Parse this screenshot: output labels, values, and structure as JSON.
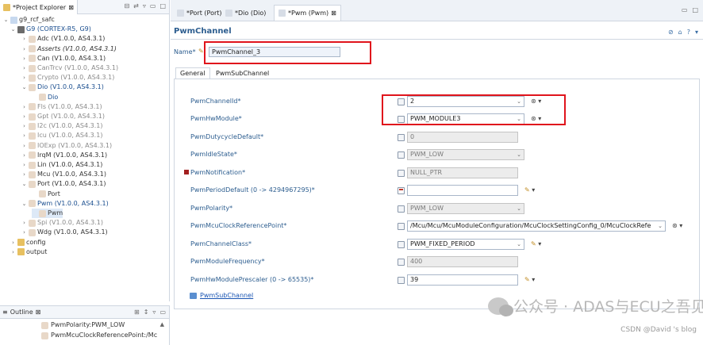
{
  "project_explorer": {
    "title": "*Project Explorer",
    "tree": [
      {
        "label": "g9_rcf_safc",
        "depth": 0,
        "twisty": "v",
        "icon": "project-icon",
        "color": "dark"
      },
      {
        "label": "G9 (CORTEX-R5, G9)",
        "depth": 1,
        "twisty": "v",
        "icon": "chip-icon",
        "color": "blue"
      },
      {
        "label": "Adc (V1.0.0, AS4.3.1)",
        "depth": 2,
        "twisty": ">",
        "icon": "module-icon",
        "color": "dark"
      },
      {
        "label": "Asserts (V1.0.0, AS4.3.1)",
        "depth": 2,
        "twisty": ">",
        "icon": "module-icon",
        "color": "dark",
        "italic": true
      },
      {
        "label": "Can (V1.0.0, AS4.3.1)",
        "depth": 2,
        "twisty": ">",
        "icon": "module-icon",
        "color": "dark"
      },
      {
        "label": "CanTrcv (V1.0.0, AS4.3.1)",
        "depth": 2,
        "twisty": ">",
        "icon": "module-icon",
        "color": "grey"
      },
      {
        "label": "Crypto (V1.0.0, AS4.3.1)",
        "depth": 2,
        "twisty": ">",
        "icon": "module-icon",
        "color": "grey"
      },
      {
        "label": "Dio (V1.0.0, AS4.3.1)",
        "depth": 2,
        "twisty": "v",
        "icon": "module-icon",
        "color": "blue"
      },
      {
        "label": "Dio",
        "depth": 3,
        "twisty": "",
        "icon": "module-icon",
        "color": "blue"
      },
      {
        "label": "Fls (V1.0.0, AS4.3.1)",
        "depth": 2,
        "twisty": ">",
        "icon": "module-icon",
        "color": "grey"
      },
      {
        "label": "Gpt (V1.0.0, AS4.3.1)",
        "depth": 2,
        "twisty": ">",
        "icon": "module-icon",
        "color": "grey"
      },
      {
        "label": "I2c (V1.0.0, AS4.3.1)",
        "depth": 2,
        "twisty": ">",
        "icon": "module-icon",
        "color": "grey"
      },
      {
        "label": "Icu (V1.0.0, AS4.3.1)",
        "depth": 2,
        "twisty": ">",
        "icon": "module-icon",
        "color": "grey"
      },
      {
        "label": "IOExp (V1.0.0, AS4.3.1)",
        "depth": 2,
        "twisty": ">",
        "icon": "module-icon",
        "color": "grey"
      },
      {
        "label": "IrqM (V1.0.0, AS4.3.1)",
        "depth": 2,
        "twisty": ">",
        "icon": "module-icon",
        "color": "dark"
      },
      {
        "label": "Lin (V1.0.0, AS4.3.1)",
        "depth": 2,
        "twisty": ">",
        "icon": "module-icon",
        "color": "dark"
      },
      {
        "label": "Mcu (V1.0.0, AS4.3.1)",
        "depth": 2,
        "twisty": ">",
        "icon": "module-icon",
        "color": "dark"
      },
      {
        "label": "Port (V1.0.0, AS4.3.1)",
        "depth": 2,
        "twisty": "v",
        "icon": "module-icon",
        "color": "dark"
      },
      {
        "label": "Port",
        "depth": 3,
        "twisty": "",
        "icon": "module-icon",
        "color": "dark"
      },
      {
        "label": "Pwm (V1.0.0, AS4.3.1)",
        "depth": 2,
        "twisty": "v",
        "icon": "module-icon",
        "color": "blue"
      },
      {
        "label": "Pwm",
        "depth": 3,
        "twisty": "",
        "icon": "module-icon",
        "color": "dark",
        "selected": true
      },
      {
        "label": "Spi (V1.0.0, AS4.3.1)",
        "depth": 2,
        "twisty": ">",
        "icon": "module-icon",
        "color": "grey"
      },
      {
        "label": "Wdg (V1.0.0, AS4.3.1)",
        "depth": 2,
        "twisty": ">",
        "icon": "module-icon",
        "color": "dark"
      },
      {
        "label": "config",
        "depth": 1,
        "twisty": ">",
        "icon": "folder-icon",
        "color": "dark"
      },
      {
        "label": "output",
        "depth": 1,
        "twisty": ">",
        "icon": "folder-icon",
        "color": "dark"
      }
    ]
  },
  "outline": {
    "title": "Outline",
    "items": [
      "PwmPolarity:PWM_LOW",
      "PwmMcuClockReferencePoint:/Mc"
    ]
  },
  "editor": {
    "tabs": [
      "*Port (Port)",
      "*Dio (Dio)",
      "*Pwm (Pwm)"
    ],
    "title": "PwmChannel",
    "name_label": "Name*",
    "name_value": "PwmChannel_3",
    "form_tabs": [
      "General",
      "PwmSubChannel"
    ],
    "fields": [
      {
        "label": "PwmChannelId*",
        "value": "2",
        "kind": "select",
        "disabled": false,
        "icon": "doc",
        "action": "link"
      },
      {
        "label": "PwmHwModule*",
        "value": "PWM_MODULE3",
        "kind": "select",
        "disabled": false,
        "icon": "doc",
        "action": "link"
      },
      {
        "label": "PwmDutycycleDefault*",
        "value": "0",
        "kind": "text",
        "disabled": true,
        "icon": "doc",
        "action": ""
      },
      {
        "label": "PwmIdleState*",
        "value": "PWM_LOW",
        "kind": "select",
        "disabled": true,
        "icon": "doc",
        "action": ""
      },
      {
        "label": "PwmNotification*",
        "value": "NULL_PTR",
        "kind": "text",
        "disabled": true,
        "icon": "doc",
        "action": ""
      },
      {
        "label": "PwmPeriodDefault (0 -> 4294967295)*",
        "value": "",
        "kind": "text",
        "disabled": false,
        "icon": "cal",
        "action": "edit"
      },
      {
        "label": "PwmPolarity*",
        "value": "PWM_LOW",
        "kind": "select",
        "disabled": true,
        "icon": "doc",
        "action": ""
      },
      {
        "label": "PwmMcuClockReferencePoint*",
        "value": "/Mcu/Mcu/McuModuleConfiguration/McuClockSettingConfig_0/McuClockRefe",
        "kind": "select",
        "disabled": false,
        "icon": "doc",
        "action": "link"
      },
      {
        "label": "PwmChannelClass*",
        "value": "PWM_FIXED_PERIOD",
        "kind": "select",
        "disabled": false,
        "icon": "doc",
        "action": "edit"
      },
      {
        "label": "PwmModuleFrequency*",
        "value": "400",
        "kind": "text",
        "disabled": true,
        "icon": "doc",
        "action": ""
      },
      {
        "label": "PwmHwModulePrescaler (0 -> 65535)*",
        "value": "39",
        "kind": "text",
        "disabled": false,
        "icon": "doc",
        "action": "edit"
      }
    ],
    "sub_link": "PwmSubChannel"
  },
  "watermark": "公众号 · ADAS与ECU之吾见",
  "credit": "CSDN @David 's blog",
  "colors": {
    "accent_blue": "#2c5d8f",
    "highlight_red": "#e0141c",
    "selection": "#dde9f7"
  }
}
